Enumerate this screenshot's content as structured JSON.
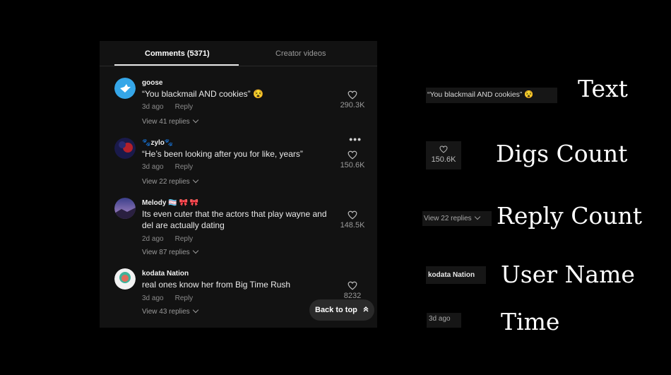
{
  "tabs": {
    "comments": "Comments (5371)",
    "creator_videos": "Creator videos"
  },
  "comments": [
    {
      "user": "goose",
      "text": "“You blackmail AND cookies” 😵",
      "time": "3d ago",
      "reply": "Reply",
      "view_replies": "View 41 replies",
      "likes": "290.3K"
    },
    {
      "user": "🐾zylo🐾",
      "text": "“He’s been looking after you for like, years”",
      "time": "3d ago",
      "reply": "Reply",
      "view_replies": "View 22 replies",
      "likes": "150.6K",
      "more": "•••"
    },
    {
      "user": "Melody 🏳️‍⚧️ 🎀 🎀",
      "text": "Its even cuter that the actors that play wayne and del are actually dating",
      "time": "2d ago",
      "reply": "Reply",
      "view_replies": "View 87 replies",
      "likes": "148.5K"
    },
    {
      "user": "kodata Nation",
      "text": "real ones know her from Big Time Rush",
      "time": "3d ago",
      "reply": "Reply",
      "view_replies": "View 43 replies",
      "likes": "8232"
    }
  ],
  "back_to_top": "Back to top",
  "annotations": {
    "text": {
      "sample": "“You blackmail AND cookies” 😵",
      "label": "Text"
    },
    "digs": {
      "sample": "150.6K",
      "label": "Digs Count"
    },
    "reply": {
      "sample": "View 22 replies",
      "label": "Reply Count"
    },
    "user": {
      "sample": "kodata Nation",
      "label": "User Name"
    },
    "time": {
      "sample": "3d ago",
      "label": "Time"
    }
  }
}
